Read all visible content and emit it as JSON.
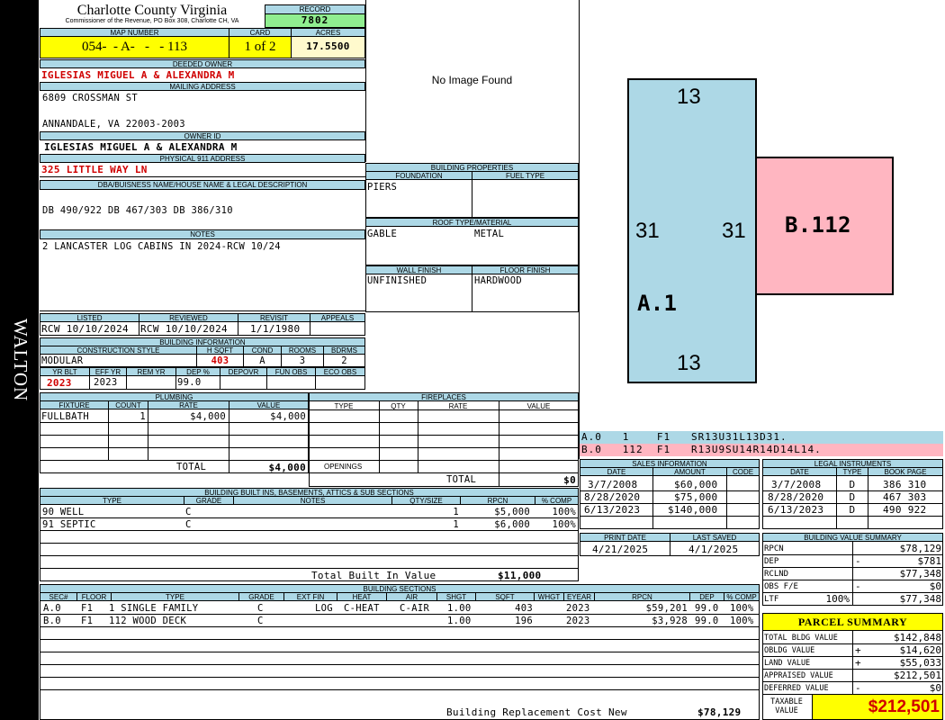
{
  "side_label": "WALTON",
  "header": {
    "title": "Charlotte County Virginia",
    "subtitle": "Commissioner of the Revenue, PO Box 308, Charlotte CH, VA",
    "record_label": "RECORD",
    "record": "7802",
    "map_number_label": "MAP NUMBER",
    "map_number": "054-  - A-   -   - 113",
    "card_label": "CARD",
    "card": "1 of 2",
    "acres_label": "ACRES",
    "acres": "17.5500"
  },
  "owner": {
    "deeded_owner_label": "DEEDED OWNER",
    "deeded_owner": "IGLESIAS MIGUEL A & ALEXANDRA M",
    "mailing_address_label": "MAILING ADDRESS",
    "address_line1": "6809 CROSSMAN ST",
    "address_line2": "ANNANDALE, VA 22003-2003",
    "owner_id_label": "OWNER ID",
    "owner_id": "IGLESIAS MIGUEL A & ALEXANDRA M",
    "physical_label": "PHYSICAL 911 ADDRESS",
    "physical_address": "325 LITTLE WAY LN",
    "dba_label": "DBA/BUISNESS NAME/HOUSE NAME & LEGAL DESCRIPTION",
    "legal_description": "DB 490/922 DB 467/303 DB 386/310",
    "notes_label": "NOTES",
    "notes": "2 LANCASTER LOG CABINS IN 2024-RCW 10/24"
  },
  "image_placeholder": "No Image Found",
  "building_properties": {
    "title": "BUILDING PROPERTIES",
    "foundation_label": "FOUNDATION",
    "foundation": "PIERS",
    "fuel_type_label": "FUEL TYPE",
    "fuel_type": "",
    "roof_label": "ROOF TYPE/MATERIAL",
    "roof_type": "GABLE",
    "roof_material": "METAL",
    "wall_finish_label": "WALL FINISH",
    "wall_finish": "UNFINISHED",
    "floor_finish_label": "FLOOR FINISH",
    "floor_finish": "HARDWOOD"
  },
  "sketch": {
    "a_label": "A.1",
    "b_label": "B.112",
    "a_top": "13",
    "a_bottom": "13",
    "a_left": "31",
    "a_right": "31",
    "a_color": "#add8e6",
    "b_color": "#ffb6c1",
    "lines": [
      {
        "text": "A.0   1    F1   SR13U31L13D31.",
        "color": "#add8e6"
      },
      {
        "text": "B.0   112  F1   R13U9SU14R14D14L14.",
        "color": "#ffb6c1"
      }
    ]
  },
  "review": {
    "listed_label": "LISTED",
    "listed": "RCW 10/10/2024",
    "reviewed_label": "REVIEWED",
    "reviewed": "RCW 10/10/2024",
    "revisit_label": "REVISIT",
    "revisit": "1/1/1980",
    "appeals_label": "APPEALS",
    "appeals": ""
  },
  "building_info": {
    "title": "BUILDING INFORMATION",
    "construction_style_label": "CONSTRUCTION STYLE",
    "construction_style": "MODULAR",
    "hsqft_label": "H SQFT",
    "hsqft": "403",
    "cond_label": "COND",
    "cond": "A",
    "rooms_label": "ROOMS",
    "rooms": "3",
    "bdrms_label": "BDRMS",
    "bdrms": "2",
    "yr_blt_label": "YR BLT",
    "yr_blt": "2023",
    "eff_yr_label": "EFF YR",
    "eff_yr": "2023",
    "rem_yr_label": "REM YR",
    "rem_yr": "",
    "dep_pct_label": "DEP %",
    "dep_pct": "99.0",
    "depovr_label": "DEPOVR",
    "depovr": "",
    "fun_obs_label": "FUN OBS",
    "fun_obs": "",
    "eco_obs_label": "ECO OBS",
    "eco_obs": ""
  },
  "plumbing": {
    "title": "PLUMBING",
    "headers": [
      "FIXTURE",
      "COUNT",
      "RATE",
      "VALUE"
    ],
    "rows": [
      [
        "FULLBATH",
        "1",
        "$4,000",
        "$4,000"
      ]
    ],
    "total_label": "TOTAL",
    "total": "$4,000"
  },
  "fireplaces": {
    "title": "FIREPLACES",
    "headers": [
      "TYPE",
      "QTY",
      "RATE",
      "VALUE"
    ],
    "openings_label": "OPENINGS",
    "total_label": "TOTAL",
    "total": "$0"
  },
  "sales": {
    "title": "SALES INFORMATION",
    "headers": [
      "DATE",
      "AMOUNT",
      "CODE"
    ],
    "rows": [
      [
        "3/7/2008",
        "$60,000",
        ""
      ],
      [
        "8/28/2020",
        "$75,000",
        ""
      ],
      [
        "6/13/2023",
        "$140,000",
        ""
      ]
    ]
  },
  "legal_instruments": {
    "title": "LEGAL INSTRUMENTS",
    "headers": [
      "DATE",
      "TYPE",
      "BOOK PAGE"
    ],
    "rows": [
      [
        "3/7/2008",
        "D",
        "386 310"
      ],
      [
        "8/28/2020",
        "D",
        "467 303"
      ],
      [
        "6/13/2023",
        "D",
        "490 922"
      ]
    ]
  },
  "print_info": {
    "print_date_label": "PRINT DATE",
    "print_date": "4/21/2025",
    "last_saved_label": "LAST SAVED",
    "last_saved": "4/1/2025"
  },
  "value_summary": {
    "title": "BUILDING VALUE SUMMARY",
    "rows": [
      {
        "label": "RPCN",
        "sign": "",
        "value": "$78,129"
      },
      {
        "label": "DEP",
        "sign": "-",
        "value": "$781"
      },
      {
        "label": "RCLND",
        "sign": "",
        "value": "$77,348"
      },
      {
        "label": "OBS F/E",
        "sign": "-",
        "value": "$0"
      },
      {
        "label": "LTF",
        "pct": "100%",
        "sign": "",
        "value": "$77,348"
      }
    ]
  },
  "built_ins": {
    "title": "BUILDING BUILT INS, BASEMENTS, ATTICS & SUB SECTIONS",
    "headers": [
      "TYPE",
      "GRADE",
      "NOTES",
      "QTY/SIZE",
      "RPCN",
      "% COMP"
    ],
    "rows": [
      [
        "90 WELL",
        "C",
        "",
        "1",
        "$5,000",
        "100%"
      ],
      [
        "91 SEPTIC",
        "C",
        "",
        "1",
        "$6,000",
        "100%"
      ]
    ],
    "total_label": "Total Built In Value",
    "total": "$11,000"
  },
  "sections": {
    "title": "BUILDING SECTIONS",
    "headers": [
      "SEC#",
      "FLOOR",
      "TYPE",
      "GRADE",
      "EXT FIN",
      "HEAT",
      "AIR",
      "SHGT",
      "SQFT",
      "WHGT",
      "EYEAR",
      "RPCN",
      "DEP",
      "% COMP"
    ],
    "rows": [
      [
        "A.0",
        "F1",
        "1 SINGLE FAMILY",
        "C",
        "LOG",
        "C-HEAT",
        "C-AIR",
        "1.00",
        "403",
        "",
        "2023",
        "$59,201",
        "99.0",
        "100%"
      ],
      [
        "B.0",
        "F1",
        "112 WOOD DECK",
        "C",
        "",
        "",
        "",
        "1.00",
        "196",
        "",
        "2023",
        "$3,928",
        "99.0",
        "100%"
      ]
    ],
    "brcn_label": "Building Replacement Cost New",
    "brcn": "$78,129"
  },
  "parcel_summary": {
    "title": "PARCEL SUMMARY",
    "rows": [
      {
        "label": "TOTAL BLDG VALUE",
        "sign": "",
        "value": "$142,848"
      },
      {
        "label": "OBLDG VALUE",
        "sign": "+",
        "value": "$14,620"
      },
      {
        "label": "LAND VALUE",
        "sign": "+",
        "value": "$55,033"
      },
      {
        "label": "APPRAISED VALUE",
        "sign": "",
        "value": "$212,501"
      },
      {
        "label": "DEFERRED VALUE",
        "sign": "-",
        "value": "$0"
      }
    ],
    "taxable_label": "TAXABLE VALUE",
    "taxable": "$212,501"
  },
  "colors": {
    "header_blue": "#add8e6",
    "highlight_yellow": "#ffff00",
    "record_green": "#90ee90",
    "pink": "#ffb6c1",
    "red_text": "#d00000"
  }
}
